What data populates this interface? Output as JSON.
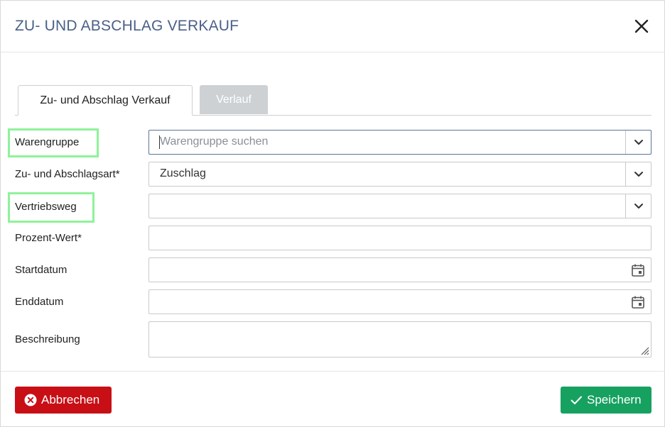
{
  "dialog": {
    "title": "ZU- UND ABSCHLAG VERKAUF",
    "close_icon": "close-icon"
  },
  "tabs": [
    {
      "label": "Zu- und Abschlag Verkauf",
      "active": true
    },
    {
      "label": "Verlauf",
      "active": false
    }
  ],
  "form": {
    "warengruppe": {
      "label": "Warengruppe",
      "placeholder": "Warengruppe suchen",
      "value": ""
    },
    "art": {
      "label": "Zu- und Abschlagsart*",
      "value": "Zuschlag"
    },
    "vertriebsweg": {
      "label": "Vertriebsweg",
      "value": ""
    },
    "prozent": {
      "label": "Prozent-Wert*",
      "value": ""
    },
    "startdatum": {
      "label": "Startdatum",
      "value": ""
    },
    "enddatum": {
      "label": "Enddatum",
      "value": ""
    },
    "beschreibung": {
      "label": "Beschreibung",
      "value": ""
    }
  },
  "footer": {
    "cancel_label": "Abbrechen",
    "save_label": "Speichern"
  },
  "colors": {
    "title": "#4a6088",
    "cancel": "#c80f16",
    "save": "#16a160",
    "highlight": "#8ff29a",
    "tab_inactive": "#cdd1d4"
  }
}
